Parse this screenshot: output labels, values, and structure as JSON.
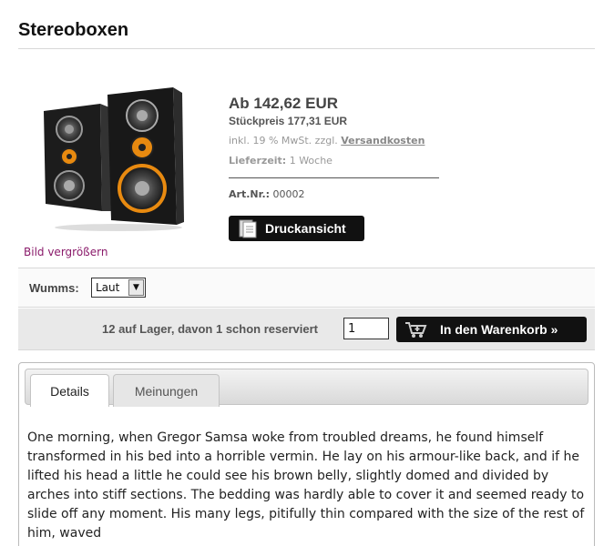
{
  "page_title": "Stereoboxen",
  "product": {
    "enlarge_link": "Bild vergrößern",
    "price_main": "Ab 142,62 EUR",
    "price_unit": "Stückpreis 177,31 EUR",
    "tax_prefix": "inkl. 19 % MwSt. zzgl.",
    "shipping_link": "Versandkosten",
    "delivery_label": "Lieferzeit:",
    "delivery_value": "1 Woche",
    "artnr_label": "Art.Nr.:",
    "artnr_value": "00002",
    "print_button": "Druckansicht"
  },
  "options": {
    "label": "Wumms:",
    "selected": "Laut"
  },
  "cart": {
    "stock_text": "12 auf Lager, davon 1 schon reserviert",
    "quantity": "1",
    "add_button": "In den Warenkorb »"
  },
  "tabs": [
    {
      "label": "Details"
    },
    {
      "label": "Meinungen"
    }
  ],
  "description": "One morning, when Gregor Samsa woke from troubled dreams, he found himself transformed in his bed into a horrible vermin. He lay on his armour-like back, and if he lifted his head a little he could see his brown belly, slightly domed and divided by arches into stiff sections. The bedding was hardly able to cover it and seemed ready to slide off any moment. His many legs, pitifully thin compared with the size of the rest of him, waved",
  "colors": {
    "link_purple": "#8a1a6a",
    "button_black": "#111111",
    "cone_orange": "#e88a10"
  }
}
